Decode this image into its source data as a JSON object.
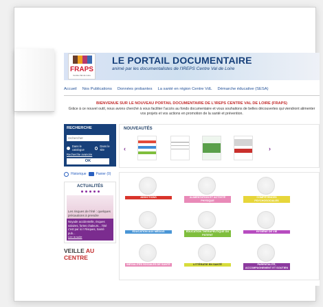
{
  "header": {
    "logo_text": "FRAPS",
    "logo_subtext": "Centre-Val de Loire",
    "title": "LE PORTAIL DOCUMENTAIRE",
    "subtitle": "animé par les documentalistes de l'IREPS Centre Val de Loire"
  },
  "nav": {
    "items": [
      "Accueil",
      "Nos Publications",
      "Données probantes",
      "La santé en région Centre VdL",
      "Démarche éducative (SESA)"
    ]
  },
  "welcome": {
    "title": "BIENVENUE SUR LE NOUVEAU PORTAIL DOCUMENTAIRE DE L'IREPS CENTRE VAL DE LOIRE (FRAPS)",
    "intro": "Grâce à ce nouvel outil, nous avons cherché à vous faciliter l'accès au fonds documentaire et vous souhaitons de belles découvertes qui viendront alimenter vos projets et vos actions en promotion de la santé et prévention."
  },
  "search": {
    "title": "RECHERCHE",
    "placeholder": "rechercher",
    "radio_catalogue": "Dans le catalogue",
    "radio_site": "Dans le site",
    "advanced_link": "Recherche avancée",
    "ok_label": "OK"
  },
  "tools": {
    "history_label": "Historique",
    "cart_label": "Panier (0)"
  },
  "news": {
    "title": "ACTUALITÉS",
    "image_caption": "Les risques de l'été : quelques précautions à prendre",
    "teaser": "Noyade accidentelle, risques solaires, fortes chaleurs... l'été c'est par ici ! Risques, Santé pub...",
    "more_link": "Lire la suite"
  },
  "veille": {
    "prefix": "VEILLE",
    "suffix": "AU CENTRE"
  },
  "nouveautes": {
    "title": "NOUVEAUTÉS",
    "prev_arrow": "‹",
    "next_arrow": "›"
  },
  "themes": [
    {
      "label": "ADDICTIONS",
      "color": "#d9342b"
    },
    {
      "label": "ALIMENTATION ET ACTIVITÉ PHYSIQUE",
      "color": "#e98ab8"
    },
    {
      "label": "COMPÉTENCES PSYCHOSOCIALES",
      "color": "#e7d63a"
    },
    {
      "label": "ÉDUCATION AUX MÉDIAS",
      "color": "#4a96d6"
    },
    {
      "label": "ÉDUCATION THÉRAPEUTIQUE DU PATIENT",
      "color": "#7fbe3d"
    },
    {
      "label": "HYGIÈNE DE VIE",
      "color": "#b74cc0"
    },
    {
      "label": "INÉGALITÉS SOCIALES DE SANTÉ",
      "color": "#e98ab8"
    },
    {
      "label": "LITTÉRATIE EN SANTÉ",
      "color": "#d7dc3b"
    },
    {
      "label": "PARENTALITÉ, ACCOMPAGNEMENT ET SOUTIEN",
      "color": "#8c3a9e"
    }
  ]
}
